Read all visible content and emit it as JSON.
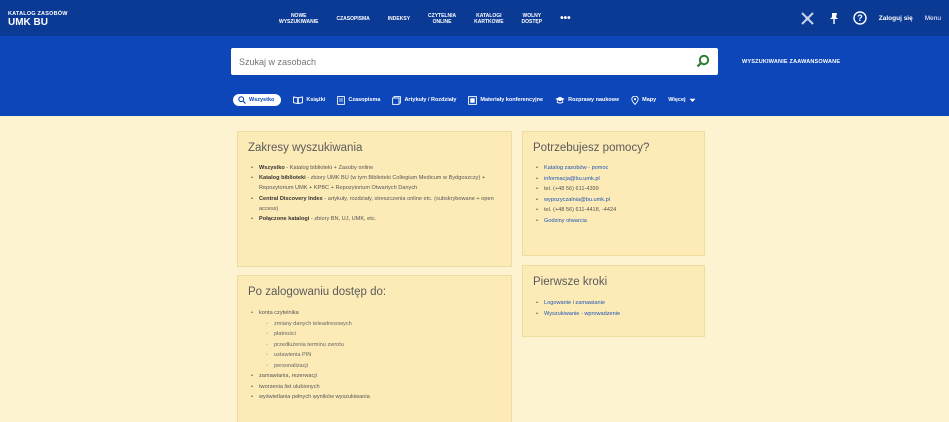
{
  "brand": {
    "line1": "KATALOG ZASOBÓW",
    "line2": "UMK BU"
  },
  "nav": [
    {
      "label": "NOWE\nWYSZUKIWANIE"
    },
    {
      "label": "CZASOPISMA"
    },
    {
      "label": "INDEKSY"
    },
    {
      "label": "CZYTELNIA\nONLINE"
    },
    {
      "label": "KATALOGI\nKARTKOWE"
    },
    {
      "label": "WOLNY\nDOSTĘP"
    },
    {
      "label": "•••"
    }
  ],
  "header_right": {
    "login": "Zaloguj się",
    "menu": "Menu"
  },
  "search": {
    "placeholder": "Szukaj w zasobach",
    "advanced": "WYSZUKIWANIE ZAAWANSOWANE"
  },
  "scopes": [
    {
      "label": "Wszystko",
      "icon": "search-icon"
    },
    {
      "label": "Książki",
      "icon": "book-icon"
    },
    {
      "label": "Czasopisma",
      "icon": "journal-icon"
    },
    {
      "label": "Artykuły / Rozdziały",
      "icon": "article-icon"
    },
    {
      "label": "Materiały konferencyjne",
      "icon": "conference-icon"
    },
    {
      "label": "Rozprawy naukowe",
      "icon": "graduation-icon"
    },
    {
      "label": "Mapy",
      "icon": "map-pin-icon"
    },
    {
      "label": "Więcej",
      "icon": "chevron-down-icon"
    }
  ],
  "scopes_card": {
    "title": "Zakresy wyszukiwania",
    "items": [
      {
        "bold": "Wszystko",
        "text": " - Katalog biblioteki + Zasoby online"
      },
      {
        "bold": "Katalog biblioteki",
        "text": " - zbiory UMK BU (w tym Biblioteki Collegium Medicum w Bydgoszczy) + Repozytorium UMK + KPBC + Repozytorium Otwartych Danych"
      },
      {
        "bold": "Central Discovery Index",
        "text": " - artykuły, rozdziały, streszczenia online etc. (subskrybowane + open access)"
      },
      {
        "bold": "Połączone katalogi",
        "text": " - zbiory BN, UJ, UMK, etc."
      }
    ]
  },
  "help_card": {
    "title": "Potrzebujesz pomocy?",
    "items": [
      "Katalog zasobów - pomoc",
      "informacja@bu.umk.pl",
      "tel. (+48 56) 611-4399",
      "wypozyczalnia@bu.umk.pl",
      "tel. (+48 56) 611-4418, -4424",
      "Godziny otwarcia"
    ]
  },
  "login_card": {
    "title": "Po zalogowaniu dostęp do:",
    "account": "konta czytelnika",
    "account_sub": [
      "zmiany danych teleadresowych",
      "płatności",
      "przedłużenia terminu zwrotu",
      "ustawienia PIN",
      "personalizacji"
    ],
    "others": [
      "zamawiania, rezerwacji",
      "tworzenia list ulubionych",
      "wyświetlania pełnych wyników wyszukiwania"
    ]
  },
  "first_steps_card": {
    "title": "Pierwsze kroki",
    "items": [
      "Logowanie i zamawianie",
      "Wyszukiwanie - wprowadzenie"
    ]
  },
  "colors": {
    "nav_bg": "#0b3a94",
    "search_bg": "#0d46b8",
    "page_bg": "#fdf3d0",
    "card_bg": "#fdebb7",
    "link": "#1d55b5",
    "search_go": "#2e7d32"
  }
}
